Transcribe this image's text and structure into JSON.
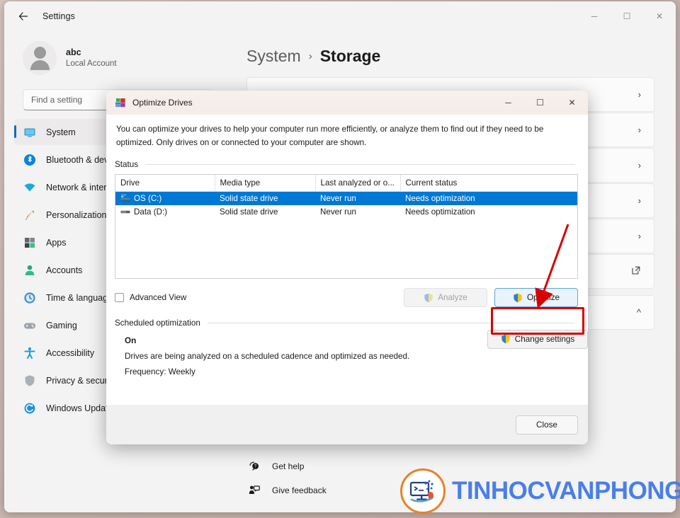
{
  "settings_window": {
    "app_title": "Settings",
    "back_icon": "back-arrow-icon",
    "caption": {
      "minimize": "─",
      "maximize": "☐",
      "close": "✕"
    },
    "account": {
      "name": "abc",
      "subtitle": "Local Account"
    },
    "search": {
      "placeholder": "Find a setting"
    },
    "sidebar_items": [
      {
        "label": "System",
        "icon": "monitor-icon",
        "active": true
      },
      {
        "label": "Bluetooth & devices",
        "icon": "bluetooth-icon",
        "active": false
      },
      {
        "label": "Network & internet",
        "icon": "wifi-icon",
        "active": false
      },
      {
        "label": "Personalization",
        "icon": "brush-icon",
        "active": false
      },
      {
        "label": "Apps",
        "icon": "apps-icon",
        "active": false
      },
      {
        "label": "Accounts",
        "icon": "person-icon",
        "active": false
      },
      {
        "label": "Time & language",
        "icon": "clock-icon",
        "active": false
      },
      {
        "label": "Gaming",
        "icon": "gamepad-icon",
        "active": false
      },
      {
        "label": "Accessibility",
        "icon": "accessibility-icon",
        "active": false
      },
      {
        "label": "Privacy & security",
        "icon": "shield-icon",
        "active": false
      },
      {
        "label": "Windows Update",
        "icon": "update-icon",
        "active": false
      }
    ],
    "breadcrumb": {
      "parent": "System",
      "separator": "›",
      "current": "Storage"
    },
    "content_rows": [
      {
        "trailing_icon": "chevron-right-icon"
      },
      {
        "trailing_icon": "chevron-right-icon"
      },
      {
        "trailing_icon": "chevron-right-icon"
      },
      {
        "trailing_icon": "chevron-right-icon"
      },
      {
        "trailing_icon": "chevron-right-icon"
      },
      {
        "trailing_icon": "external-link-icon"
      },
      {
        "trailing_icon": "chevron-up-icon"
      }
    ],
    "footer_links": [
      {
        "label": "Get help",
        "icon": "help-icon"
      },
      {
        "label": "Give feedback",
        "icon": "feedback-icon"
      }
    ]
  },
  "dialog": {
    "title": "Optimize Drives",
    "title_icon": "optimize-drives-icon",
    "caption": {
      "minimize": "─",
      "maximize": "☐",
      "close": "✕"
    },
    "intro": "You can optimize your drives to help your computer run more efficiently, or analyze them to find out if they need to be optimized. Only drives on or connected to your computer are shown.",
    "status_group_label": "Status",
    "table": {
      "columns": [
        "Drive",
        "Media type",
        "Last analyzed or o...",
        "Current status"
      ],
      "rows": [
        {
          "drive": "OS (C:)",
          "media_type": "Solid state drive",
          "last_analyzed": "Never run",
          "current_status": "Needs optimization",
          "selected": true,
          "icon": "system-drive-icon"
        },
        {
          "drive": "Data (D:)",
          "media_type": "Solid state drive",
          "last_analyzed": "Never run",
          "current_status": "Needs optimization",
          "selected": false,
          "icon": "drive-icon"
        }
      ]
    },
    "advanced_view_label": "Advanced View",
    "advanced_view_checked": false,
    "analyze_button": {
      "label": "Analyze",
      "enabled": false,
      "icon": "uac-shield-icon"
    },
    "optimize_button": {
      "label": "Optimize",
      "enabled": true,
      "icon": "uac-shield-icon",
      "highlighted": true
    },
    "scheduled_group_label": "Scheduled optimization",
    "scheduled_state": "On",
    "scheduled_description": "Drives are being analyzed on a scheduled cadence and optimized as needed.",
    "scheduled_frequency": "Frequency: Weekly",
    "change_settings_button": {
      "label": "Change settings",
      "icon": "uac-shield-icon"
    },
    "close_button": {
      "label": "Close"
    },
    "annotation": {
      "highlight_color": "#d80000",
      "arrow_color": "#d80000",
      "target": "optimize-button"
    }
  },
  "watermark": {
    "text": "TINHOCVANPHONG",
    "text_color": "#4a7ee8",
    "ring_color": "#e8812a",
    "icon": "computer-logo-icon"
  },
  "colors": {
    "accent": "#0078d4",
    "selection": "#0078d4",
    "window_bg": "#f3f3f3",
    "dialog_bg": "#ffffff",
    "annotation_red": "#d80000"
  }
}
